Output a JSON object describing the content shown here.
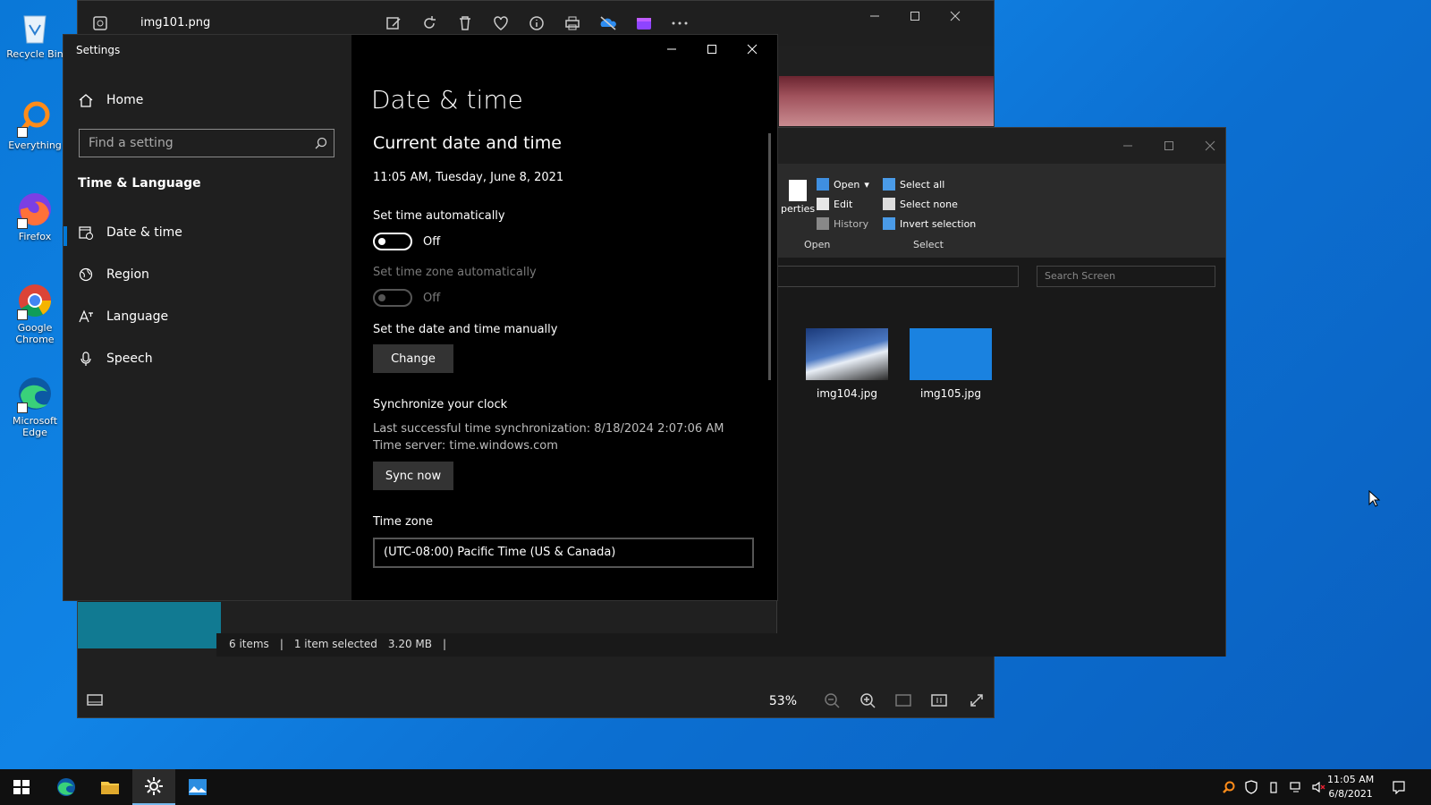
{
  "desktop": {
    "icons": [
      {
        "label": "Recycle Bin"
      },
      {
        "label": "Everything"
      },
      {
        "label": "Firefox"
      },
      {
        "label": "Google Chrome"
      },
      {
        "label": "Microsoft Edge"
      }
    ]
  },
  "photos": {
    "title": "img101.png",
    "zoom": "53%"
  },
  "explorer": {
    "ribbon": {
      "open": "Open",
      "edit": "Edit",
      "history": "History",
      "properties": "perties",
      "select_all": "Select all",
      "select_none": "Select none",
      "invert_selection": "Invert selection",
      "group_open": "Open",
      "group_select": "Select"
    },
    "search_placeholder": "Search Screen",
    "files": [
      {
        "name": "img104.jpg"
      },
      {
        "name": "img105.jpg"
      }
    ],
    "status": {
      "items": "6 items",
      "selected": "1 item selected",
      "size": "3.20 MB"
    }
  },
  "settings": {
    "app_title": "Settings",
    "home": "Home",
    "search_placeholder": "Find a setting",
    "category": "Time & Language",
    "nav": [
      "Date & time",
      "Region",
      "Language",
      "Speech"
    ],
    "page_title": "Date & time",
    "section_title": "Current date and time",
    "current_datetime": "11:05 AM, Tuesday, June 8, 2021",
    "set_time_auto_label": "Set time automatically",
    "set_time_auto_state": "Off",
    "set_tz_auto_label": "Set time zone automatically",
    "set_tz_auto_state": "Off",
    "manual_label": "Set the date and time manually",
    "change_button": "Change",
    "sync_title": "Synchronize your clock",
    "last_sync": "Last successful time synchronization: 8/18/2024 2:07:06 AM",
    "time_server": "Time server: time.windows.com",
    "sync_button": "Sync now",
    "timezone_label": "Time zone",
    "timezone_value": "(UTC-08:00) Pacific Time (US & Canada)"
  },
  "taskbar": {
    "time": "11:05 AM",
    "date": "6/8/2021"
  },
  "colors": {
    "accent": "#0078d7",
    "desktop": "#0a78d8"
  }
}
